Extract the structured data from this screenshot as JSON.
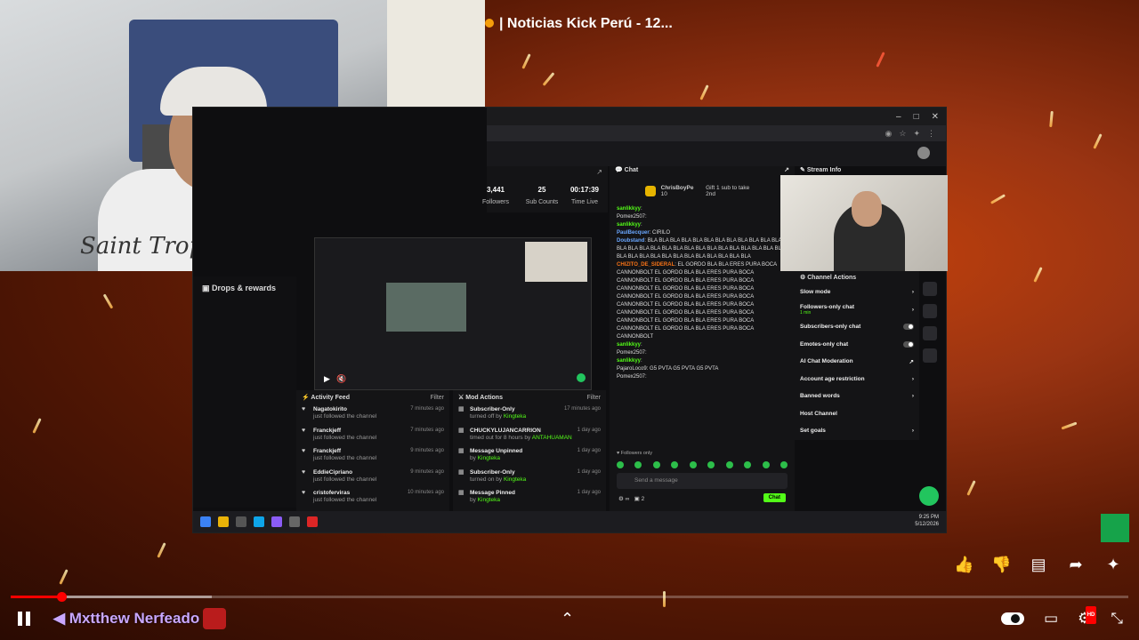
{
  "video": {
    "title": "| Noticias Kick Perú - 12...",
    "channel_name": "Mxtthew Nerfeado",
    "shirt_text": "Saint Trop"
  },
  "stream_dashboard": {
    "drops_label": "Drops & rewards",
    "stats": [
      {
        "value": "3,441",
        "label": "Followers"
      },
      {
        "value": "25",
        "label": "Sub Counts"
      },
      {
        "value": "00:17:39",
        "label": "Time Live"
      }
    ],
    "activity_feed": {
      "title": "Activity Feed",
      "filter": "Filter",
      "items": [
        {
          "name": "Nagatokirito",
          "sub": "just followed the channel",
          "time": "7 minutes ago"
        },
        {
          "name": "Franckjeff",
          "sub": "just followed the channel",
          "time": "7 minutes ago"
        },
        {
          "name": "Franckjeff",
          "sub": "just followed the channel",
          "time": "9 minutes ago"
        },
        {
          "name": "EddieCipriano",
          "sub": "just followed the channel",
          "time": "9 minutes ago"
        },
        {
          "name": "cristoferviras",
          "sub": "just followed the channel",
          "time": "10 minutes ago"
        }
      ]
    },
    "mod_actions": {
      "title": "Mod Actions",
      "filter": "Filter",
      "items": [
        {
          "name": "Subscriber-Only",
          "sub_prefix": "turned off by ",
          "by": "Kingteka",
          "time": "17 minutes ago"
        },
        {
          "name": "CHUCKYLUJANCARRION",
          "sub_prefix": "timed out for 8 hours by ",
          "by": "ANTAHUAMAN",
          "time": "1 day ago"
        },
        {
          "name": "Message Unpinned",
          "sub_prefix": "by ",
          "by": "Kingteka",
          "time": "1 day ago"
        },
        {
          "name": "Subscriber-Only",
          "sub_prefix": "turned on by ",
          "by": "Kingteka",
          "time": "1 day ago"
        },
        {
          "name": "Message Pinned",
          "sub_prefix": "by ",
          "by": "Kingteka",
          "time": "1 day ago"
        }
      ]
    },
    "chat": {
      "title": "Chat",
      "pinned_user": "ChrisBoyPe",
      "pinned_count": "10",
      "pinned_text": "Gift 1 sub to take 2nd",
      "followers_only": "Followers only",
      "input_placeholder": "Send a message",
      "send_label": "Chat",
      "footer_count": "2",
      "messages": [
        {
          "user": "sanlikkyy",
          "cls": "u-g",
          "text": ""
        },
        {
          "user": "Pomex2507",
          "cls": "",
          "text": ""
        },
        {
          "user": "sanlikkyy",
          "cls": "u-g",
          "text": ""
        },
        {
          "user": "PaulBecquer",
          "cls": "u-b",
          "text": "CIRILO"
        },
        {
          "user": "Doubstand",
          "cls": "u-b",
          "text": "BLA BLA BLA BLA BLA BLA BLA BLA BLA BLA BLA BLA BLA BLA BLA BLA BLA BLA BLA BLA BLA BLA BLA BLA BLA BLA BLA BLA BLA BLA BLA BLA BLA BLA BLA BLA BLA BLA BLA"
        },
        {
          "user": "CHIZITO_DE_SIDERAL",
          "cls": "u-o",
          "text": "EL GORDO BLA BLA ERES PURA BOCA CANNONBOLT EL GORDO BLA BLA ERES PURA BOCA CANNONBOLT EL GORDO BLA BLA ERES PURA BOCA CANNONBOLT EL GORDO BLA BLA ERES PURA BOCA CANNONBOLT EL GORDO BLA BLA ERES PURA BOCA CANNONBOLT EL GORDO BLA BLA ERES PURA BOCA CANNONBOLT EL GORDO BLA BLA ERES PURA BOCA CANNONBOLT EL GORDO BLA BLA ERES PURA BOCA CANNONBOLT EL GORDO BLA BLA ERES PURA BOCA CANNONBOLT"
        },
        {
          "user": "sanlikkyy",
          "cls": "u-g",
          "text": ""
        },
        {
          "user": "Pomex2507",
          "cls": "",
          "text": ""
        },
        {
          "user": "sanlikkyy",
          "cls": "u-g",
          "text": ""
        },
        {
          "user": "PajaroLoco9",
          "cls": "",
          "text": "G5 PVTA G5 PVTA G5 PVTA"
        },
        {
          "user": "Pomex2507",
          "cls": "",
          "text": ""
        }
      ]
    },
    "stream_info": {
      "title": "Stream Info"
    },
    "channel_actions": {
      "title": "Channel Actions",
      "items": [
        {
          "label": "Slow mode",
          "type": "arrow",
          "sub": ""
        },
        {
          "label": "Followers-only chat",
          "type": "arrow",
          "sub": "1 min"
        },
        {
          "label": "Subscribers-only chat",
          "type": "toggle",
          "sub": ""
        },
        {
          "label": "Emotes-only chat",
          "type": "toggle",
          "sub": ""
        },
        {
          "label": "AI Chat Moderation",
          "type": "ext",
          "sub": ""
        },
        {
          "label": "Account age restriction",
          "type": "arrow",
          "sub": ""
        },
        {
          "label": "Banned words",
          "type": "arrow",
          "sub": ""
        },
        {
          "label": "Host Channel",
          "type": "none",
          "sub": ""
        },
        {
          "label": "Set goals",
          "type": "arrow",
          "sub": ""
        }
      ]
    },
    "taskbar": {
      "time": "9:25 PM",
      "date": "5/12/2026"
    }
  },
  "player": {
    "progress_fraction": 0.045,
    "buffer_fraction": 0.18,
    "colors": {
      "accent": "#ff0000",
      "kick_green": "#53fc18"
    }
  }
}
